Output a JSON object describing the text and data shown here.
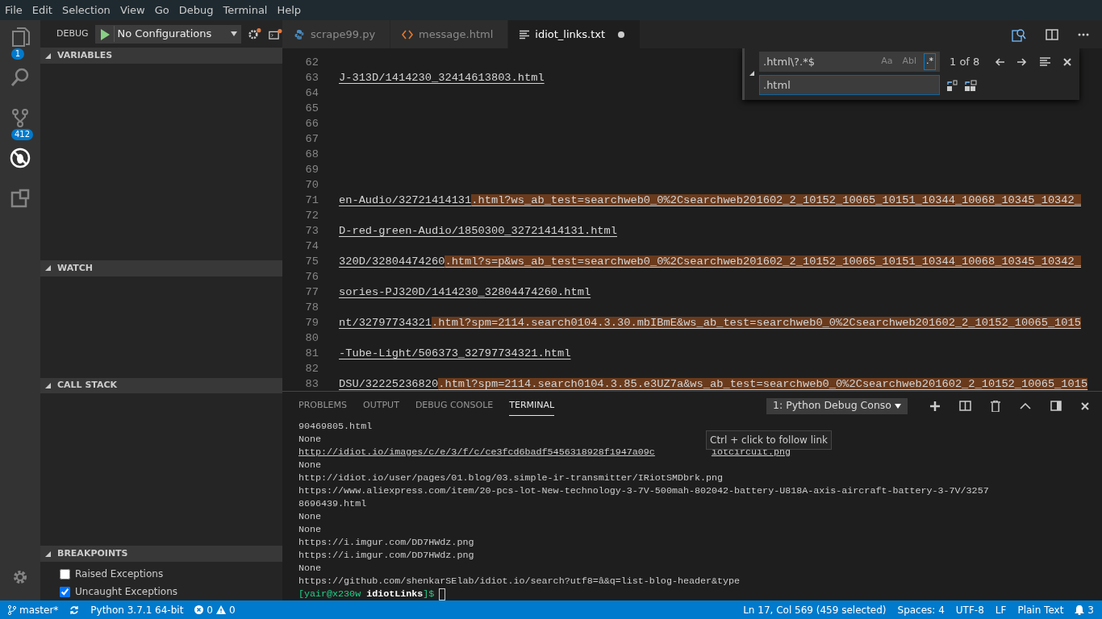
{
  "menu": [
    "File",
    "Edit",
    "Selection",
    "View",
    "Go",
    "Debug",
    "Terminal",
    "Help"
  ],
  "activity_bar": [
    {
      "kind": "files",
      "badge": "1",
      "selected": false
    },
    {
      "kind": "search",
      "selected": false
    },
    {
      "kind": "scm",
      "badge": "412",
      "selected": false
    },
    {
      "kind": "debug",
      "selected": true
    },
    {
      "kind": "extensions",
      "selected": false
    }
  ],
  "debug_toolbar": {
    "label": "DEBUG",
    "configuration": "No Configurations"
  },
  "sidebar_sections": [
    {
      "title": "VARIABLES",
      "expanded": true
    },
    {
      "title": "WATCH",
      "expanded": true
    },
    {
      "title": "CALL STACK",
      "expanded": true
    },
    {
      "title": "BREAKPOINTS",
      "expanded": true,
      "items": [
        {
          "label": "Raised Exceptions",
          "checked": false
        },
        {
          "label": "Uncaught Exceptions",
          "checked": true
        }
      ]
    }
  ],
  "editor_tabs": [
    {
      "label": "scrape99.py",
      "kind": "python",
      "selected": false,
      "modified": false
    },
    {
      "label": "message.html",
      "kind": "html",
      "selected": false,
      "modified": false
    },
    {
      "label": "idiot_links.txt",
      "kind": "text",
      "selected": true,
      "modified": true
    }
  ],
  "find_widget": {
    "find": ".html\\?.*$",
    "replace": ".html",
    "options": [
      {
        "label": "Aa",
        "on": false
      },
      {
        "label": "Abl",
        "on": false
      },
      {
        "label": ".*",
        "on": true
      }
    ],
    "count": "1 of 8",
    "replace_expanded": true
  },
  "editor_lines": [
    {
      "number": "62"
    },
    {
      "number": "63",
      "text": "J-313D/1414230_32414613803.html"
    },
    {
      "number": "64"
    },
    {
      "number": "65"
    },
    {
      "number": "66"
    },
    {
      "number": "67"
    },
    {
      "number": "68"
    },
    {
      "number": "69"
    },
    {
      "number": "70"
    },
    {
      "number": "71",
      "text": "en-Audio/32721414131",
      "match": ".html?ws_ab_test=searchweb0_0%2Csearchweb201602_2_10152_10065_10151_10344_10068_10345_10342_"
    },
    {
      "number": "72"
    },
    {
      "number": "73",
      "text": "D-red-green-Audio/1850300_32721414131.html"
    },
    {
      "number": "74"
    },
    {
      "number": "75",
      "text": "320D/32804474260",
      "match": ".html?s=p&ws_ab_test=searchweb0_0%2Csearchweb201602_2_10152_10065_10151_10344_10068_10345_10342_"
    },
    {
      "number": "76"
    },
    {
      "number": "77",
      "text": "sories-PJ320D/1414230_32804474260.html"
    },
    {
      "number": "78"
    },
    {
      "number": "79",
      "text": "nt/32797734321",
      "match": ".html?spm=2114.search0104.3.30.mbIBmE&ws_ab_test=searchweb0_0%2Csearchweb201602_2_10152_10065_1015"
    },
    {
      "number": "80"
    },
    {
      "number": "81",
      "text": "-Tube-Light/506373_32797734321.html"
    },
    {
      "number": "82"
    },
    {
      "number": "83",
      "text": "DSU/32225236820",
      "match": ".html?spm=2114.search0104.3.85.e3UZ7a&ws_ab_test=searchweb0_0%2Csearchweb201602_2_10152_10065_1015"
    }
  ],
  "panel": {
    "tabs": [
      {
        "label": "PROBLEMS",
        "selected": false
      },
      {
        "label": "OUTPUT",
        "selected": false
      },
      {
        "label": "DEBUG CONSOLE",
        "selected": false
      },
      {
        "label": "TERMINAL",
        "selected": true
      }
    ],
    "terminal_selector": "1: Python Debug Conso",
    "tooltip": "Ctrl + click to follow link",
    "lines": [
      {
        "text": "90469805.html"
      },
      {
        "text": "None"
      },
      {
        "text": "http://idiot.io/images/c/e/3/f/c/ce3fcd6badf5456318928f1947a09c",
        "hovered": true,
        "tail": "iotcircuit.png"
      },
      {
        "text": "None"
      },
      {
        "text": "http://idiot.io/user/pages/01.blog/03.simple-ir-transmitter/IRiotSMDbrk.png"
      },
      {
        "text": "https://www.aliexpress.com/item/20-pcs-lot-New-technology-3-7V-500mah-802042-battery-U818A-axis-aircraft-battery-3-7V/3257"
      },
      {
        "text": "8696439.html"
      },
      {
        "text": "None"
      },
      {
        "text": "None"
      },
      {
        "text": "https://i.imgur.com/DD7HWdz.png"
      },
      {
        "text": "https://i.imgur.com/DD7HWdz.png"
      },
      {
        "text": "None"
      },
      {
        "text": "https://github.com/shenkarSElab/idiot.io/search?utf8=â&q=list-blog-header&type"
      }
    ],
    "prompt": {
      "user": "[yair@x230w",
      "dir": "idiotLinks",
      "end": "]$"
    }
  },
  "status_bar": {
    "branch": "master*",
    "interpreter": "Python 3.7.1 64-bit",
    "errors": "0",
    "warnings": "0",
    "position": "Ln 17, Col 569 (459 selected)",
    "indent": "Spaces: 4",
    "encoding": "UTF-8",
    "eol": "LF",
    "language": "Plain Text",
    "notifications": "3"
  }
}
